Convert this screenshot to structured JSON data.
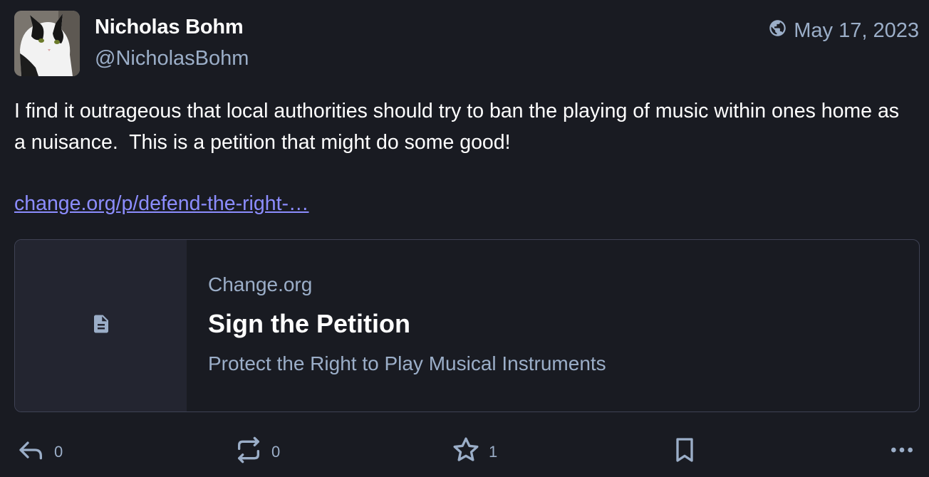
{
  "author": {
    "display_name": "Nicholas Bohm",
    "handle": "@NicholasBohm"
  },
  "meta": {
    "visibility_icon": "globe-icon",
    "date": "May 17, 2023"
  },
  "content": {
    "text": "I find it outrageous that local authorities should try to ban the playing of music within ones home as a nuisance.  This is a petition that might do some good!",
    "link_text": "change.org/p/defend-the-right-…"
  },
  "card": {
    "provider": "Change.org",
    "title": "Sign the Petition",
    "description": "Protect the Right to Play Musical Instruments",
    "icon": "document-icon"
  },
  "actions": {
    "reply_count": "0",
    "boost_count": "0",
    "favourite_count": "1"
  },
  "colors": {
    "background": "#191b22",
    "secondary_text": "#9baec8",
    "link": "#8c8dff",
    "card_border": "#3f4254"
  }
}
